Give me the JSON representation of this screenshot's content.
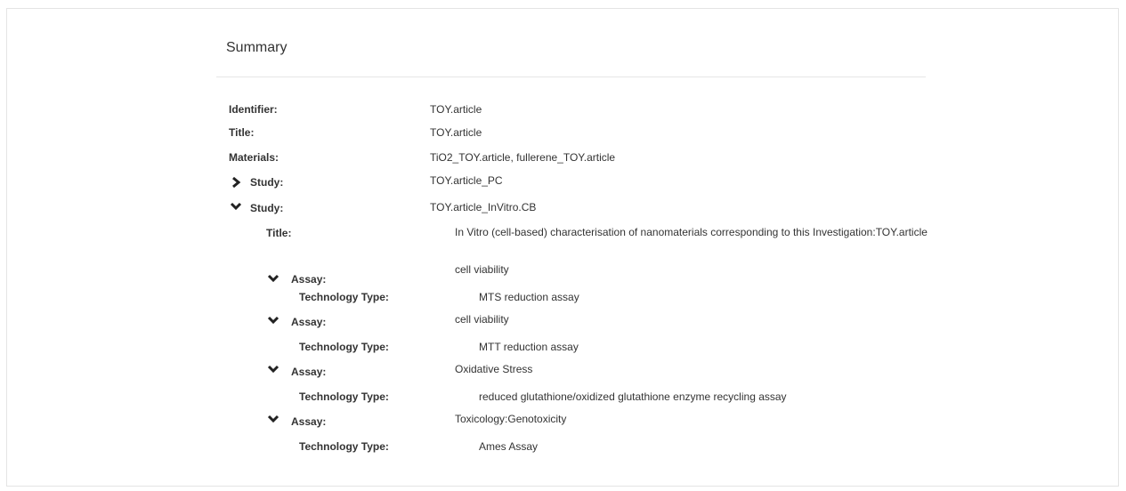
{
  "summary": {
    "title": "Summary"
  },
  "fields": {
    "identifier_label": "Identifier:",
    "identifier_value": "TOY.article",
    "title_label": "Title:",
    "title_value": "TOY.article",
    "materials_label": "Materials:",
    "materials_value": "TiO2_TOY.article, fullerene_TOY.article"
  },
  "studies": [
    {
      "label": "Study:",
      "value": "TOY.article_PC",
      "expanded": false,
      "icon": "chevron-right-icon"
    },
    {
      "label": "Study:",
      "value": "TOY.article_InVitro.CB",
      "expanded": true,
      "icon": "chevron-down-icon",
      "title_label": "Title:",
      "title_value": "In Vitro (cell-based) characterisation of nanomaterials corresponding to this Investigation:TOY.article",
      "assays": [
        {
          "label": "Assay:",
          "value": "cell viability",
          "tech_label": "Technology Type:",
          "tech_value": "MTS reduction assay"
        },
        {
          "label": "Assay:",
          "value": "cell viability",
          "tech_label": "Technology Type:",
          "tech_value": "MTT reduction assay"
        },
        {
          "label": "Assay:",
          "value": "Oxidative Stress",
          "tech_label": "Technology Type:",
          "tech_value": "reduced glutathione/oxidized glutathione enzyme recycling assay"
        },
        {
          "label": "Assay:",
          "value": "Toxicology:Genotoxicity",
          "tech_label": "Technology Type:",
          "tech_value": "Ames Assay"
        }
      ]
    }
  ]
}
